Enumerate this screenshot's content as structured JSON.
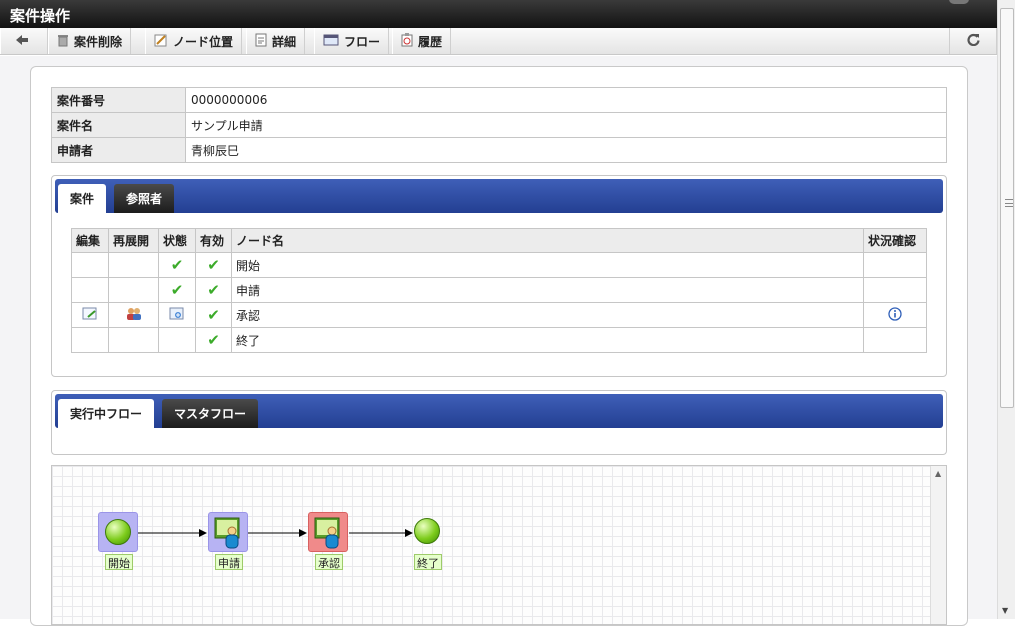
{
  "window": {
    "title": "案件操作"
  },
  "toolbar": {
    "back_label": "",
    "delete_label": "案件削除",
    "node_position_label": "ノード位置",
    "detail_label": "詳細",
    "flow_label": "フロー",
    "history_label": "履歴"
  },
  "info": {
    "rows": [
      {
        "key": "案件番号",
        "value": "0000000006"
      },
      {
        "key": "案件名",
        "value": "サンプル申請"
      },
      {
        "key": "申請者",
        "value": "青柳辰巳"
      }
    ]
  },
  "case_tabs": {
    "active": "案件",
    "inactive": "参照者"
  },
  "nodes_table": {
    "headers": [
      "編集",
      "再展開",
      "状態",
      "有効",
      "ノード名",
      "状況確認"
    ],
    "rows": [
      {
        "name": "開始",
        "status": "check",
        "enabled": "check"
      },
      {
        "name": "申請",
        "status": "check",
        "enabled": "check"
      },
      {
        "name": "承認",
        "status": "in-progress",
        "enabled": "check",
        "editable": true,
        "reexpand": true,
        "info": true
      },
      {
        "name": "終了",
        "status": "",
        "enabled": "check"
      }
    ]
  },
  "flow_tabs": {
    "active": "実行中フロー",
    "inactive": "マスタフロー"
  },
  "flow": {
    "nodes": [
      {
        "label": "開始",
        "kind": "start",
        "state": "done"
      },
      {
        "label": "申請",
        "kind": "user",
        "state": "done"
      },
      {
        "label": "承認",
        "kind": "user",
        "state": "current"
      },
      {
        "label": "終了",
        "kind": "end",
        "state": "pending"
      }
    ]
  },
  "colors": {
    "tab_bar": "#2f4ea6",
    "done_highlight": "#b7b3f3",
    "current_highlight": "#f08a8a",
    "check": "#3cab2a"
  }
}
